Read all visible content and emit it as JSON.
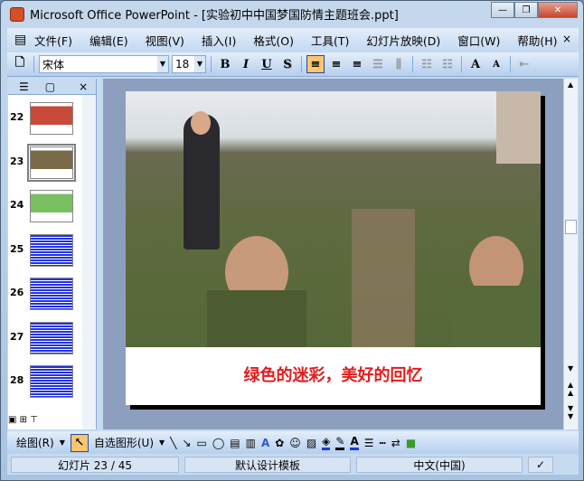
{
  "window": {
    "title": "Microsoft Office PowerPoint - [实验初中中国梦国防情主题班会.ppt]",
    "minimize": "—",
    "restore": "❐",
    "close": "✕"
  },
  "menu": {
    "items": [
      "文件(F)",
      "编辑(E)",
      "视图(V)",
      "插入(I)",
      "格式(O)",
      "工具(T)",
      "幻灯片放映(D)",
      "窗口(W)",
      "帮助(H)"
    ],
    "close": "×"
  },
  "format_toolbar": {
    "font": "宋体",
    "size": "18",
    "bold": "B",
    "italic": "I",
    "underline": "U",
    "shadow": "S",
    "grow": "A",
    "shrink": "A"
  },
  "pane": {
    "close": "×",
    "slides": [
      22,
      23,
      24,
      25,
      26,
      27,
      28
    ],
    "current": 23
  },
  "slide": {
    "caption": "绿色的迷彩，美好的回忆"
  },
  "draw_toolbar": {
    "draw": "绘图(R)",
    "autoshapes": "自选图形(U)"
  },
  "status": {
    "slide": "幻灯片 23 / 45",
    "template": "默认设计模板",
    "language": "中文(中国)"
  },
  "colors": {
    "accent": "#fbc571",
    "caption": "#e51a1a"
  }
}
